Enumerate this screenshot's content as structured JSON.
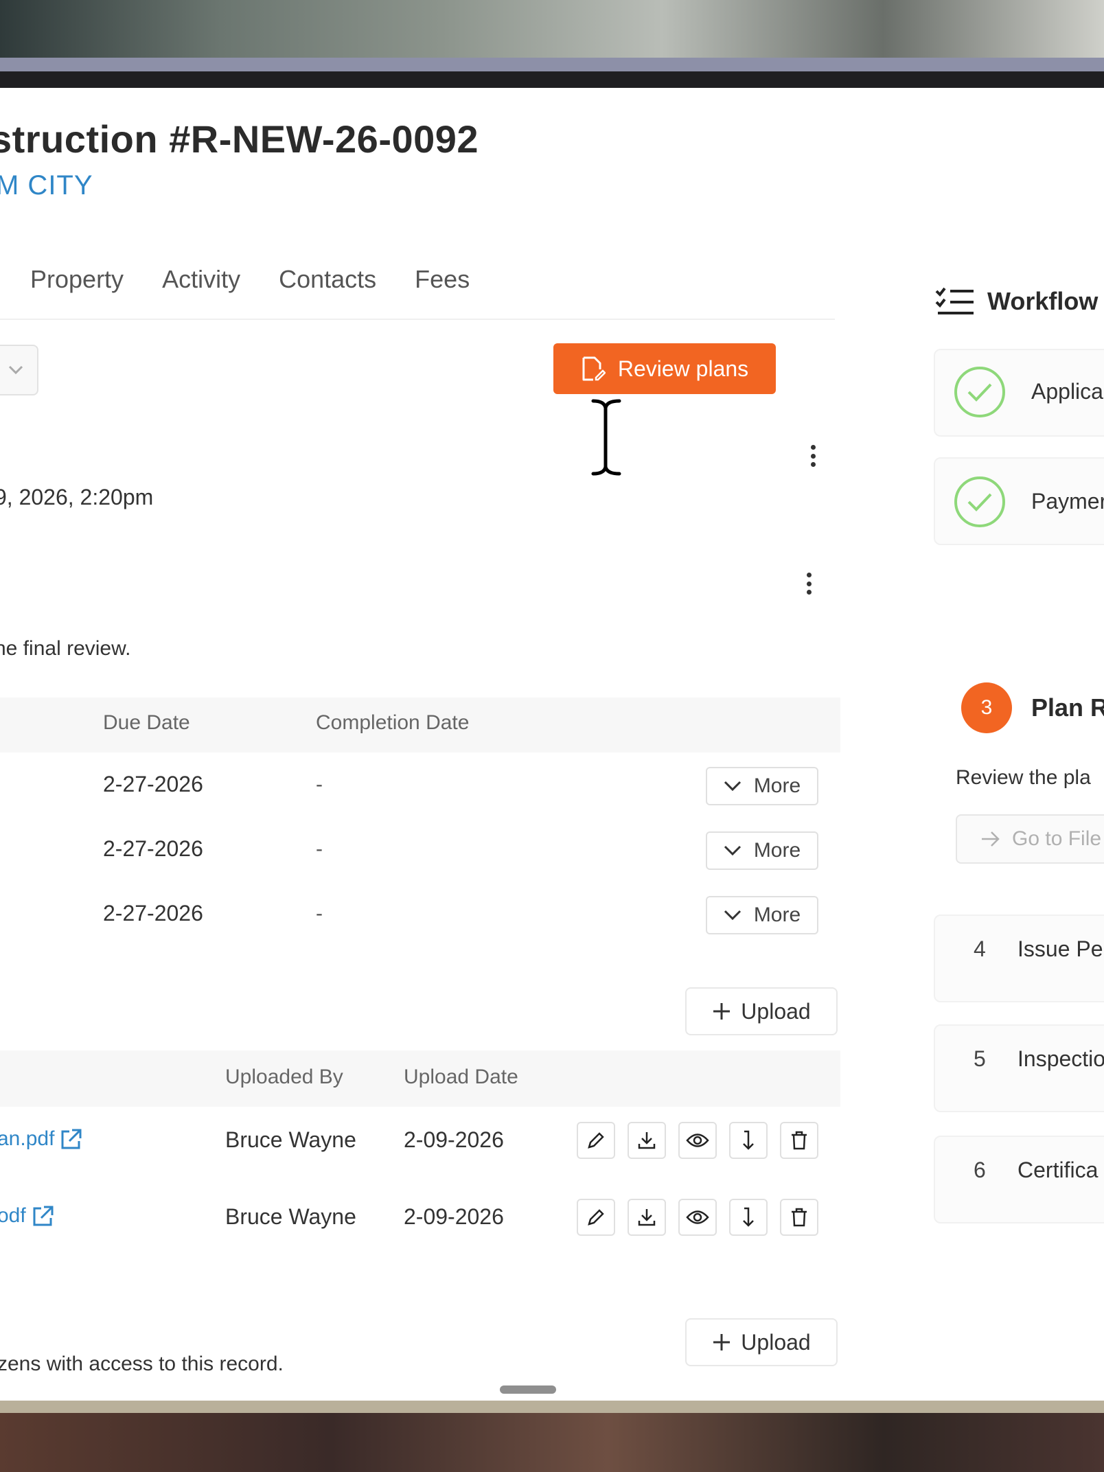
{
  "header": {
    "title": "struction #R-NEW-26-0092",
    "subtitle": "M CITY"
  },
  "tabs": [
    "Property",
    "Activity",
    "Contacts",
    "Fees"
  ],
  "actions": {
    "review_plans_label": "Review plans"
  },
  "record": {
    "date_text": "9, 2026, 2:20pm",
    "final_review_text": "he final review.",
    "access_text": "zens with access to this record."
  },
  "tasks_table": {
    "headers": [
      "Due Date",
      "Completion Date"
    ],
    "rows": [
      {
        "due": "2-27-2026",
        "completed": "-",
        "action": "More"
      },
      {
        "due": "2-27-2026",
        "completed": "-",
        "action": "More"
      },
      {
        "due": "2-27-2026",
        "completed": "-",
        "action": "More"
      }
    ]
  },
  "upload_label": "Upload",
  "files_table": {
    "headers": [
      "Uploaded By",
      "Upload Date"
    ],
    "rows": [
      {
        "name": "an.pdf",
        "uploaded_by": "Bruce Wayne",
        "date": "2-09-2026"
      },
      {
        "name": "odf",
        "uploaded_by": "Bruce Wayne",
        "date": "2-09-2026"
      }
    ]
  },
  "workflow": {
    "title": "Workflow",
    "steps": [
      {
        "label": "Applica",
        "status": "complete"
      },
      {
        "label": "Paymer",
        "status": "complete"
      },
      {
        "number": "3",
        "label": "Plan R",
        "status": "current",
        "description": "Review the pla",
        "button": "Go to File"
      },
      {
        "number": "4",
        "label": "Issue Pe"
      },
      {
        "number": "5",
        "label": "Inspectio"
      },
      {
        "number": "6",
        "label": "Certifica"
      }
    ]
  },
  "colors": {
    "accent": "#f26522",
    "link": "#2f86c7",
    "complete": "#8ed87a"
  }
}
